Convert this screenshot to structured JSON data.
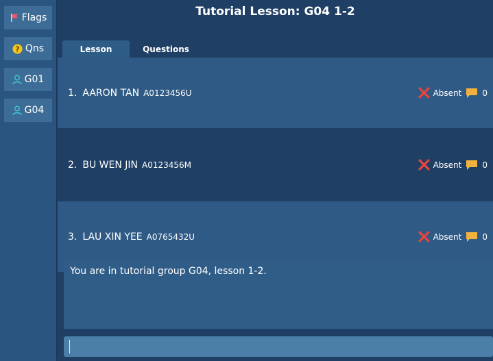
{
  "sidebar": {
    "items": [
      {
        "label": "Flags",
        "icon": "flag-icon"
      },
      {
        "label": "Qns",
        "icon": "question-icon"
      },
      {
        "label": "G01",
        "icon": "user-icon"
      },
      {
        "label": "G04",
        "icon": "user-icon"
      }
    ]
  },
  "header": {
    "title": "Tutorial Lesson: G04 1-2"
  },
  "tabs": [
    {
      "label": "Lesson",
      "active": true
    },
    {
      "label": "Questions",
      "active": false
    }
  ],
  "students": [
    {
      "index": "1.",
      "name": "AARON TAN",
      "id": "A0123456U",
      "status": "Absent",
      "comments": "0"
    },
    {
      "index": "2.",
      "name": "BU WEN JIN",
      "id": "A0123456M",
      "status": "Absent",
      "comments": "0"
    },
    {
      "index": "3.",
      "name": "LAU XIN YEE",
      "id": "A0765432U",
      "status": "Absent",
      "comments": "0"
    }
  ],
  "result_display": {
    "text": "You are in tutorial group G04, lesson 1-2."
  },
  "command_box": {
    "value": ""
  },
  "colors": {
    "absent_icon": "#e8453c",
    "comment_icon": "#f0b13e",
    "flag_icon": "#e85a6a",
    "question_icon": "#f5c518",
    "user_icon": "#3fc7d4"
  }
}
